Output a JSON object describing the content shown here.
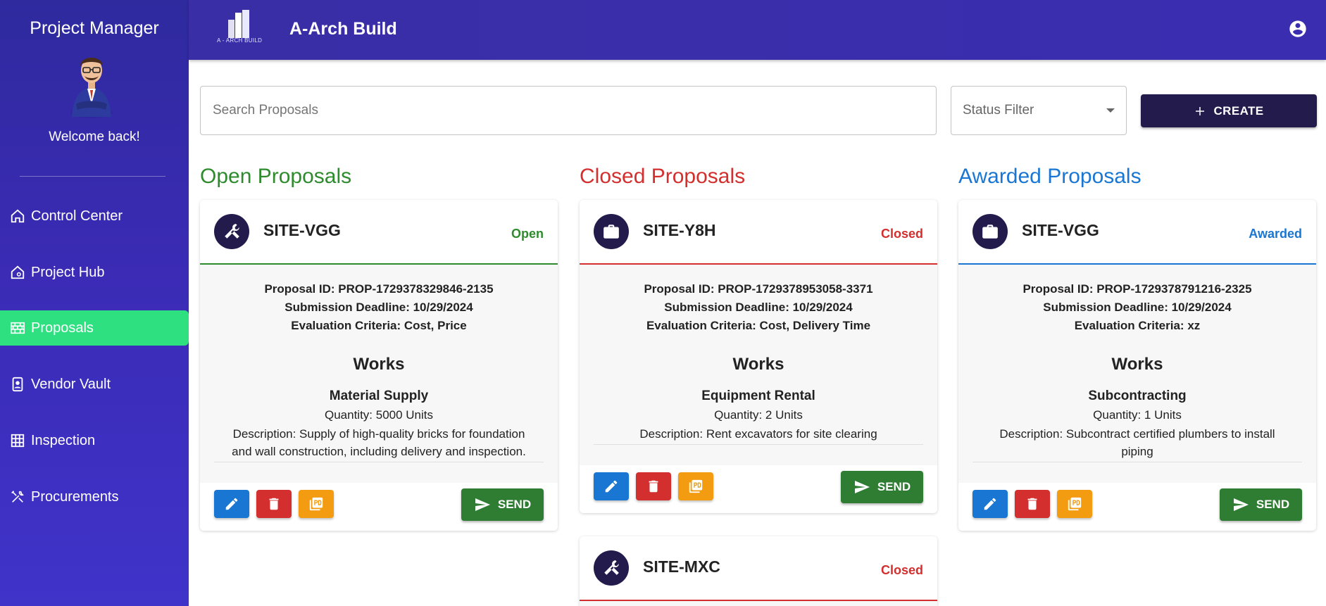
{
  "sidebar": {
    "title": "Project Manager",
    "welcome": "Welcome back!",
    "items": [
      {
        "label": "Control Center",
        "icon": "home-icon"
      },
      {
        "label": "Project Hub",
        "icon": "home-gear-icon"
      },
      {
        "label": "Proposals",
        "icon": "wall-icon",
        "active": true
      },
      {
        "label": "Vendor Vault",
        "icon": "contact-icon"
      },
      {
        "label": "Inspection",
        "icon": "grid-icon"
      },
      {
        "label": "Procurements",
        "icon": "tools-icon"
      }
    ]
  },
  "header": {
    "logo_text": "A - ARCH BUILD",
    "title": "A-Arch Build",
    "account_icon": "account-circle-icon"
  },
  "toolbar": {
    "search_placeholder": "Search Proposals",
    "status_filter_label": "Status Filter",
    "create_label": "CREATE"
  },
  "columns": {
    "open": {
      "title": "Open Proposals",
      "color": "#2e8b2e",
      "cards": [
        {
          "site": "SITE-VGG",
          "icon": "tools-icon",
          "status": "Open",
          "proposal_id": "Proposal ID: PROP-1729378329846-2135",
          "deadline": "Submission Deadline: 10/29/2024",
          "criteria": "Evaluation Criteria: Cost, Price",
          "works": "Works",
          "type": "Material Supply",
          "quantity": "Quantity: 5000 Units",
          "description": "Description: Supply of high-quality bricks for foundation and wall construction, including delivery and inspection.",
          "send_label": "SEND"
        }
      ]
    },
    "closed": {
      "title": "Closed Proposals",
      "color": "#d32f2f",
      "cards": [
        {
          "site": "SITE-Y8H",
          "icon": "briefcase-icon",
          "status": "Closed",
          "proposal_id": "Proposal ID: PROP-1729378953058-3371",
          "deadline": "Submission Deadline: 10/29/2024",
          "criteria": "Evaluation Criteria: Cost, Delivery Time",
          "works": "Works",
          "type": "Equipment Rental",
          "quantity": "Quantity: 2 Units",
          "description": "Description: Rent excavators for site clearing",
          "send_label": "SEND"
        },
        {
          "site": "SITE-MXC",
          "icon": "tools-icon",
          "status": "Closed"
        }
      ]
    },
    "awarded": {
      "title": "Awarded Proposals",
      "color": "#1976d2",
      "cards": [
        {
          "site": "SITE-VGG",
          "icon": "briefcase-icon",
          "status": "Awarded",
          "proposal_id": "Proposal ID: PROP-1729378791216-2325",
          "deadline": "Submission Deadline: 10/29/2024",
          "criteria": "Evaluation Criteria: xz",
          "works": "Works",
          "type": "Subcontracting",
          "quantity": "Quantity: 1 Units",
          "description": "Description: Subcontract certified plumbers to install piping",
          "send_label": "SEND"
        }
      ]
    }
  }
}
